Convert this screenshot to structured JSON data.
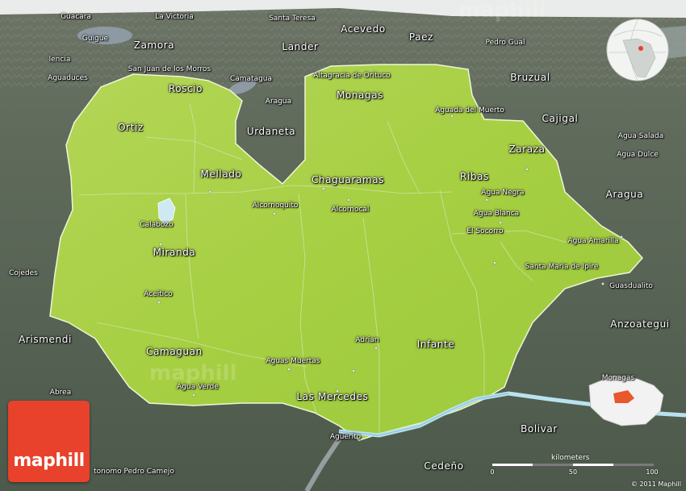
{
  "brand": {
    "logo_text": "maphill",
    "watermark": "maphill",
    "copyright": "© 2011 Maphill",
    "logo_color": "#e8412c"
  },
  "colors": {
    "region_fill": "#a8d040",
    "surround_fill": "#5a6657",
    "water": "#b9e2ef",
    "roads": "#d8e8b8"
  },
  "scale": {
    "title": "kilometers",
    "ticks": [
      "0",
      "50",
      "100"
    ]
  },
  "labels": {
    "guacara": "Guacara",
    "la_victoria": "La Victoria",
    "santa_teresa": "Santa Teresa",
    "guigue": "Guigue",
    "zamora": "Zamora",
    "lander": "Lander",
    "acevedo": "Acevedo",
    "paez": "Paez",
    "pedro_gual": "Pedro Gual",
    "valencia": "lencia",
    "san_juan": "San Juan de los Morros",
    "camatagua": "Camatagua",
    "altagracia": "Altagracia de Orituco",
    "brusual": "Bruzual",
    "aguaduces": "Aguaduces",
    "roscio": "Roscio",
    "aragua_n": "Aragua",
    "monagas": "Monagas",
    "aguada": "Aguada del Muerto",
    "cajigal": "Cajigal",
    "ortiz": "Ortiz",
    "urdaneta": "Urdaneta",
    "zaraza": "Zaraza",
    "agua_salada": "Agua Salada",
    "agua_dulce": "Agua Dulce",
    "mellado": "Mellado",
    "chaguaramas": "Chaguaramas",
    "ribas": "Ribas",
    "agua_negra": "Agua Negra",
    "aragua_e": "Aragua",
    "alcornoquito": "Alcornoquito",
    "alcornocal": "Alcornocal",
    "agua_blanca": "Agua Blanca",
    "calabozo": "Calabozo",
    "el_socorro": "El Socorro",
    "agua_amarilla": "Agua Amarilla",
    "cojedes": "Cojedes",
    "miranda": "Miranda",
    "santa_maria": "Santa Maria de Ipire",
    "guasdualito": "Guasdualito",
    "aceitico": "Aceitico",
    "arismendi": "Arismendi",
    "anzoategui": "Anzoategui",
    "adrian": "Adrian",
    "infante": "Infante",
    "camaguan": "Camaguan",
    "aguas_muertas": "Aguas Muertas",
    "monagas_se": "Monagas",
    "agua_verde": "Agua Verde",
    "las_mercedes": "Las Mercedes",
    "abrea": "Abrea",
    "bolivar": "Bolivar",
    "aguerito": "Aguerito",
    "pedro_camejo": "tonomo Pedro Camejo",
    "cedeno": "Cedeño"
  }
}
